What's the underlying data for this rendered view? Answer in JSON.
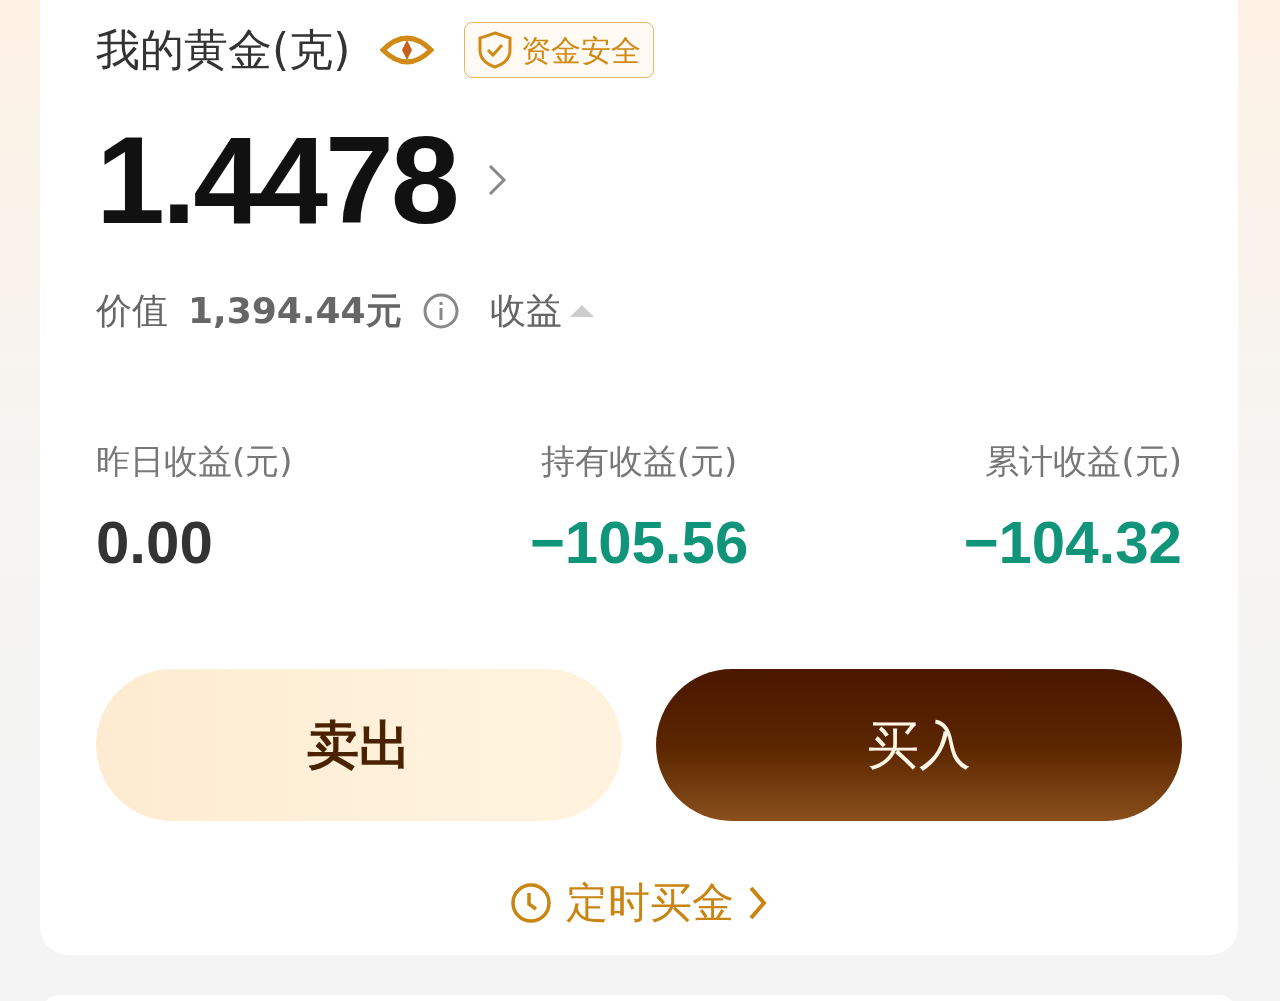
{
  "header": {
    "title": "我的黄金(克)",
    "badge": "资金安全"
  },
  "holdings": {
    "amount": "1.4478",
    "value_label": "价值",
    "value": "1,394.44元",
    "profit_label": "收益"
  },
  "stats": [
    {
      "label": "昨日收益(元)",
      "value": "0.00",
      "color": "#333333"
    },
    {
      "label": "持有收益(元)",
      "value": "−105.56",
      "color": "#11957a"
    },
    {
      "label": "累计收益(元)",
      "value": "−104.32",
      "color": "#11957a"
    }
  ],
  "buttons": [
    {
      "label": "卖出",
      "kind": "secondary"
    },
    {
      "label": "买入",
      "kind": "primary"
    }
  ],
  "link": "定时买金"
}
